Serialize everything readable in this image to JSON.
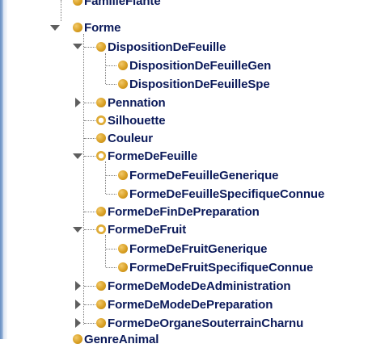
{
  "tree": {
    "nodes": [
      {
        "label": "FamilleFlante"
      },
      {
        "label": "Forme"
      },
      {
        "label": "DispositionDeFeuille"
      },
      {
        "label": "DispositionDeFeuilleGen"
      },
      {
        "label": "DispositionDeFeuilleSpe"
      },
      {
        "label": "Pennation"
      },
      {
        "label": "Silhouette"
      },
      {
        "label": "Couleur"
      },
      {
        "label": "FormeDeFeuille"
      },
      {
        "label": "FormeDeFeuilleGenerique"
      },
      {
        "label": "FormeDeFeuilleSpecifiqueConnue"
      },
      {
        "label": "FormeDeFinDePreparation"
      },
      {
        "label": "FormeDeFruit"
      },
      {
        "label": "FormeDeFruitGenerique"
      },
      {
        "label": "FormeDeFruitSpecifiqueConnue"
      },
      {
        "label": "FormeDeModeDeAdministration"
      },
      {
        "label": "FormeDeModeDePreparation"
      },
      {
        "label": "FormeDeOrganeSouterrainCharnu"
      },
      {
        "label": "GenreAnimal"
      }
    ]
  }
}
